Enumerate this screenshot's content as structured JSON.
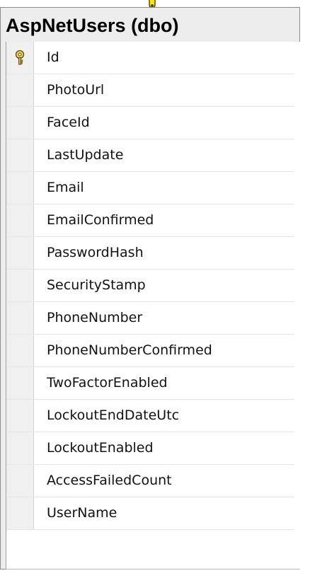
{
  "table": {
    "title": "AspNetUsers (dbo)",
    "columns": [
      {
        "name": "Id",
        "is_primary_key": true
      },
      {
        "name": "PhotoUrl",
        "is_primary_key": false
      },
      {
        "name": "FaceId",
        "is_primary_key": false
      },
      {
        "name": "LastUpdate",
        "is_primary_key": false
      },
      {
        "name": "Email",
        "is_primary_key": false
      },
      {
        "name": "EmailConfirmed",
        "is_primary_key": false
      },
      {
        "name": "PasswordHash",
        "is_primary_key": false
      },
      {
        "name": "SecurityStamp",
        "is_primary_key": false
      },
      {
        "name": "PhoneNumber",
        "is_primary_key": false
      },
      {
        "name": "PhoneNumberConfirmed",
        "is_primary_key": false
      },
      {
        "name": "TwoFactorEnabled",
        "is_primary_key": false
      },
      {
        "name": "LockoutEndDateUtc",
        "is_primary_key": false
      },
      {
        "name": "LockoutEnabled",
        "is_primary_key": false
      },
      {
        "name": "AccessFailedCount",
        "is_primary_key": false
      },
      {
        "name": "UserName",
        "is_primary_key": false
      }
    ]
  },
  "icons": {
    "primary_key": "key-icon",
    "connector_marker": "relationship-marker-icon"
  },
  "colors": {
    "panel_background": "#ededed",
    "grid_background": "#ffffff",
    "row_header_background": "#f0f0f0",
    "border": "#8d8d8d",
    "grid_line": "#e6e6e6",
    "key_fill": "#f3d14b",
    "key_outline": "#5d4a1a",
    "connector_marker_fill": "#ffe600",
    "text": "#111111"
  }
}
